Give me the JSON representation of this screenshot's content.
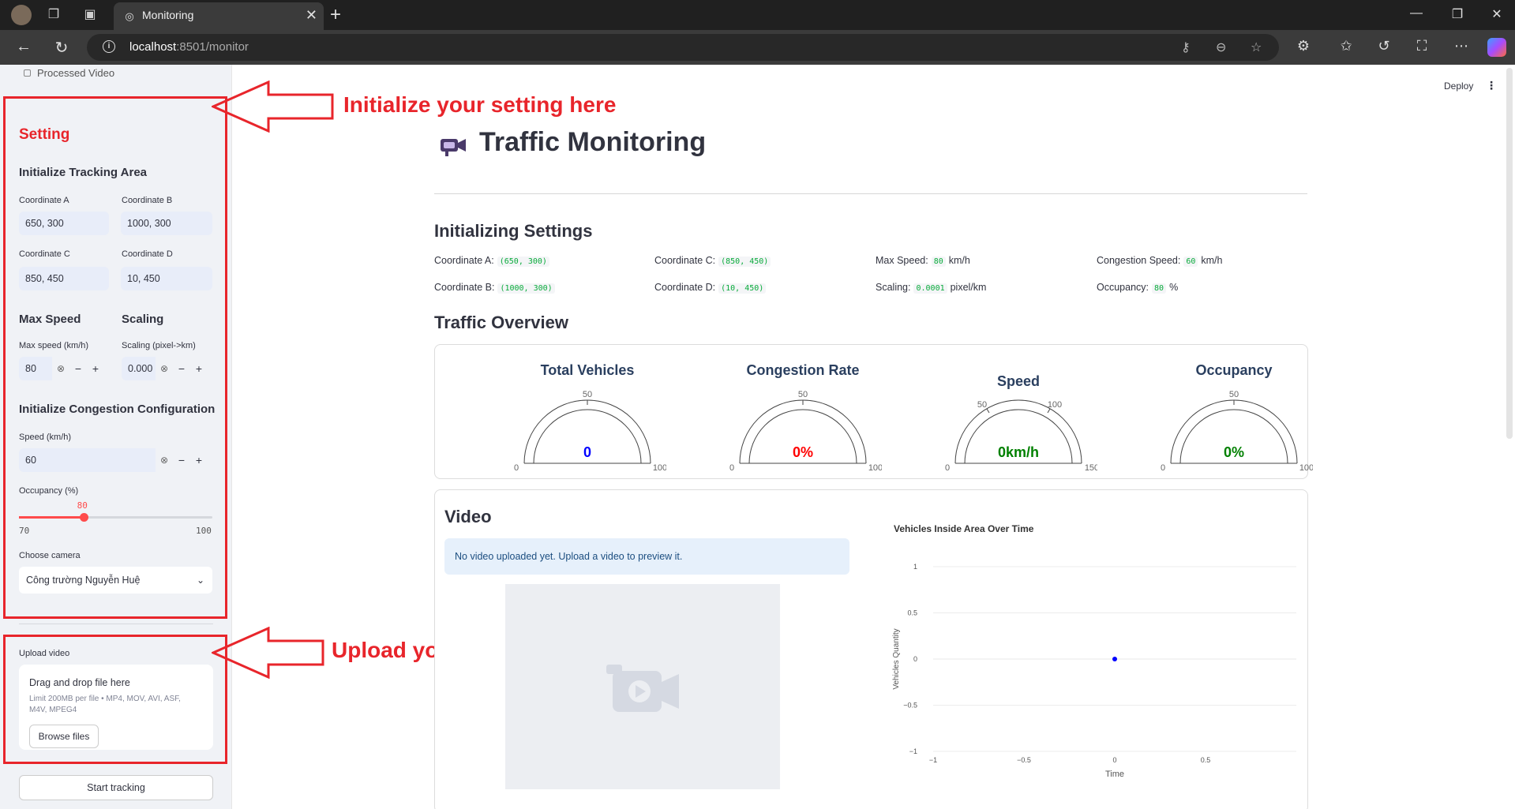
{
  "browser": {
    "tab_title": "Monitoring",
    "url_host": "localhost",
    "url_rest": ":8501/monitor"
  },
  "sidebar": {
    "nav_item": "Processed Video",
    "setting_header": "Setting",
    "tracking_header": "Initialize Tracking Area",
    "coord_a_label": "Coordinate A",
    "coord_a_value": "650, 300",
    "coord_b_label": "Coordinate B",
    "coord_b_value": "1000, 300",
    "coord_c_label": "Coordinate C",
    "coord_c_value": "850, 450",
    "coord_d_label": "Coordinate D",
    "coord_d_value": "10, 450",
    "max_speed_header": "Max Speed",
    "scaling_header": "Scaling",
    "max_speed_label": "Max speed (km/h)",
    "max_speed_value": "80",
    "scaling_label": "Scaling (pixel->km)",
    "scaling_value": "0.000",
    "congestion_header": "Initialize Congestion Configuration",
    "speed_label": "Speed (km/h)",
    "speed_value": "60",
    "occupancy_label": "Occupancy (%)",
    "occupancy_value": "80",
    "occupancy_min": "70",
    "occupancy_max": "100",
    "occupancy_fraction": 0.333,
    "camera_label": "Choose camera",
    "camera_value": "Công trường Nguyễn Huệ",
    "upload_label": "Upload video",
    "upload_dd": "Drag and drop file here",
    "upload_limit": "Limit 200MB per file • MP4, MOV, AVI, ASF, M4V, MPEG4",
    "browse_label": "Browse files",
    "start_label": "Start tracking"
  },
  "annotations": {
    "settings_note": "Initialize your setting here",
    "upload_note": "Upload your video here",
    "color": "#e8252b"
  },
  "main": {
    "deploy_label": "Deploy",
    "title": "Traffic Monitoring",
    "init_header": "Initializing Settings",
    "settings": {
      "coord_a_label": "Coordinate A:",
      "coord_a": "(650, 300)",
      "coord_b_label": "Coordinate B:",
      "coord_b": "(1000, 300)",
      "coord_c_label": "Coordinate C:",
      "coord_c": "(850, 450)",
      "coord_d_label": "Coordinate D:",
      "coord_d": "(10, 450)",
      "max_speed_label": "Max Speed:",
      "max_speed": "80",
      "max_speed_unit": "km/h",
      "scaling_label": "Scaling:",
      "scaling": "0.0001",
      "scaling_unit": "pixel/km",
      "congestion_label": "Congestion Speed:",
      "congestion": "60",
      "congestion_unit": "km/h",
      "occupancy_label": "Occupancy:",
      "occupancy": "80",
      "occupancy_unit": "%"
    },
    "overview_header": "Traffic Overview",
    "gauges": [
      {
        "title": "Total Vehicles",
        "value": "0",
        "min": "0",
        "mid": "50",
        "max": "100",
        "color": "#0000ff"
      },
      {
        "title": "Congestion Rate",
        "value": "0%",
        "min": "0",
        "mid": "50",
        "max": "100",
        "color": "#ff0000"
      },
      {
        "title": "Speed",
        "value": "0km/h",
        "min": "0",
        "t1": "50",
        "t2": "100",
        "max": "150",
        "color": "#008000"
      },
      {
        "title": "Occupancy",
        "value": "0%",
        "min": "0",
        "mid": "50",
        "max": "100",
        "color": "#008000"
      }
    ],
    "video_header": "Video",
    "video_info": "No video uploaded yet. Upload a video to preview it."
  },
  "chart_data": {
    "type": "scatter",
    "title": "Vehicles Inside Area Over Time",
    "xlabel": "Time",
    "ylabel": "Vehicles Quantity",
    "x": [
      0
    ],
    "y": [
      0
    ],
    "xlim": [
      -1,
      1
    ],
    "ylim": [
      -1,
      1
    ],
    "xticks": [
      "−1",
      "−0.5",
      "0",
      "0.5"
    ],
    "yticks": [
      "1",
      "0.5",
      "0",
      "−0.5",
      "−1"
    ],
    "grid": true,
    "point_color": "#0000ff"
  }
}
